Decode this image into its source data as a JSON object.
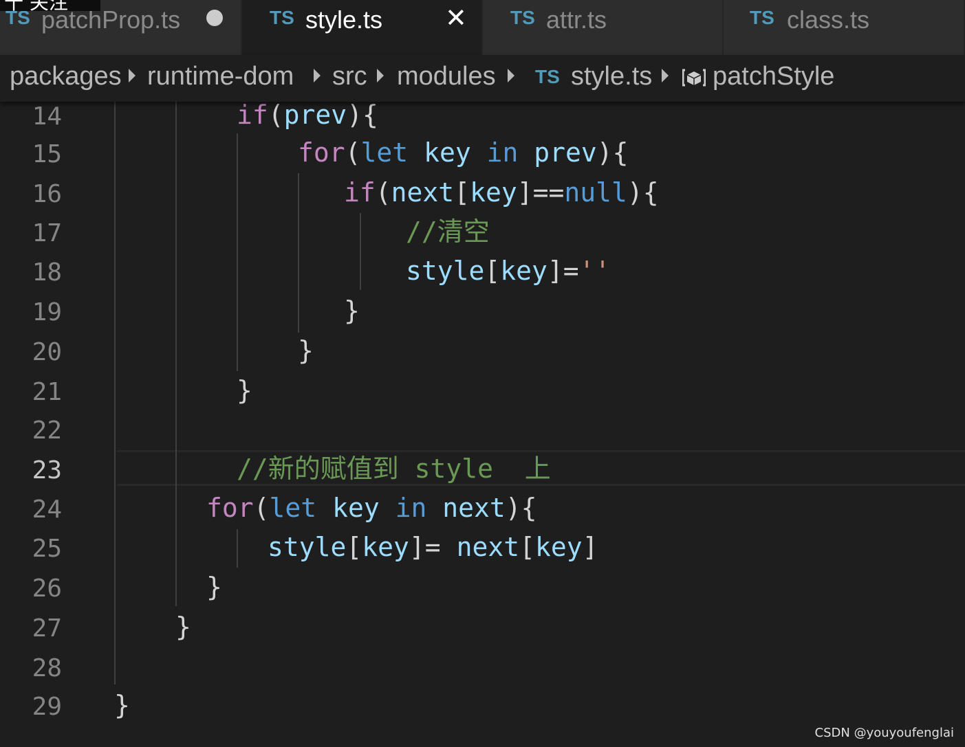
{
  "overlay": {
    "text": "十 关注"
  },
  "tabs": [
    {
      "icon": "TS",
      "label": "patchProp.ts",
      "modified": true
    },
    {
      "icon": "TS",
      "label": "style.ts",
      "active": true,
      "close": "✕"
    },
    {
      "icon": "TS",
      "label": "attr.ts"
    },
    {
      "icon": "TS",
      "label": "class.ts"
    }
  ],
  "breadcrumb": {
    "items": [
      "packages",
      "runtime-dom",
      "src",
      "modules",
      "style.ts",
      "patchStyle"
    ],
    "file_icon": "TS",
    "symbol_icon": "symbol-method-icon"
  },
  "editor": {
    "current_line": 23,
    "lines": [
      {
        "number": "14",
        "tokens": [
          [
            "kw",
            "if"
          ],
          [
            "punc",
            "("
          ],
          [
            "var",
            "prev"
          ],
          [
            "punc",
            "){"
          ]
        ]
      },
      {
        "number": "15",
        "tokens": [
          [
            "kw",
            "for"
          ],
          [
            "punc",
            "("
          ],
          [
            "decl",
            "let"
          ],
          [
            "punc",
            " "
          ],
          [
            "var",
            "key"
          ],
          [
            "punc",
            " "
          ],
          [
            "decl",
            "in"
          ],
          [
            "punc",
            " "
          ],
          [
            "var",
            "prev"
          ],
          [
            "punc",
            "){"
          ]
        ]
      },
      {
        "number": "16",
        "tokens": [
          [
            "kw",
            "if"
          ],
          [
            "punc",
            "("
          ],
          [
            "var",
            "next"
          ],
          [
            "punc",
            "["
          ],
          [
            "var",
            "key"
          ],
          [
            "punc",
            "]=="
          ],
          [
            "decl",
            "null"
          ],
          [
            "punc",
            "){"
          ]
        ]
      },
      {
        "number": "17",
        "tokens": [
          [
            "comment",
            "//清空"
          ]
        ]
      },
      {
        "number": "18",
        "tokens": [
          [
            "var",
            "style"
          ],
          [
            "punc",
            "["
          ],
          [
            "var",
            "key"
          ],
          [
            "punc",
            "]="
          ],
          [
            "str",
            "''"
          ]
        ]
      },
      {
        "number": "19",
        "tokens": [
          [
            "punc",
            "}"
          ]
        ]
      },
      {
        "number": "20",
        "tokens": [
          [
            "punc",
            "}"
          ]
        ]
      },
      {
        "number": "21",
        "tokens": [
          [
            "punc",
            "}"
          ]
        ]
      },
      {
        "number": "22",
        "tokens": []
      },
      {
        "number": "23",
        "tokens": [
          [
            "comment",
            "//新的赋值到 style  上"
          ]
        ]
      },
      {
        "number": "24",
        "tokens": [
          [
            "kw",
            "for"
          ],
          [
            "punc",
            "("
          ],
          [
            "decl",
            "let"
          ],
          [
            "punc",
            " "
          ],
          [
            "var",
            "key"
          ],
          [
            "punc",
            " "
          ],
          [
            "decl",
            "in"
          ],
          [
            "punc",
            " "
          ],
          [
            "var",
            "next"
          ],
          [
            "punc",
            "){"
          ]
        ]
      },
      {
        "number": "25",
        "tokens": [
          [
            "var",
            "style"
          ],
          [
            "punc",
            "["
          ],
          [
            "var",
            "key"
          ],
          [
            "punc",
            "]= "
          ],
          [
            "var",
            "next"
          ],
          [
            "punc",
            "["
          ],
          [
            "var",
            "key"
          ],
          [
            "punc",
            "]"
          ]
        ]
      },
      {
        "number": "26",
        "tokens": [
          [
            "punc",
            "}"
          ]
        ]
      },
      {
        "number": "27",
        "tokens": [
          [
            "punc",
            "}"
          ]
        ]
      },
      {
        "number": "28",
        "tokens": []
      },
      {
        "number": "29",
        "tokens": [
          [
            "punc",
            "}"
          ]
        ]
      }
    ]
  },
  "watermark": "CSDN @youyoufenglai",
  "colors": {
    "keyword": "#c586c0",
    "declaration": "#569cd6",
    "variable": "#9cdcfe",
    "string": "#ce9178",
    "comment": "#6a9955",
    "ts_icon": "#519aba"
  }
}
